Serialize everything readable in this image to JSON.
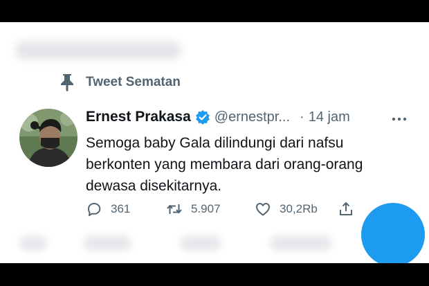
{
  "pinned": {
    "label": "Tweet Sematan",
    "icon": "pin-icon"
  },
  "tweet": {
    "author_name": "Ernest Prakasa",
    "verified_icon": "verified-badge-icon",
    "handle": "@ernestpr...",
    "separator": "·",
    "time": "14 jam",
    "text_lines": [
      "Semoga baby Gala dilindungi dari nafsu",
      "berkonten yang membara dari orang-orang",
      "dewasa disekitarnya."
    ],
    "actions": {
      "reply_count": "361",
      "retweet_count": "5.907",
      "like_count": "30,2Rb"
    }
  },
  "colors": {
    "accent": "#1d9bf0",
    "text_primary": "#0f1419",
    "text_secondary": "#536471"
  }
}
